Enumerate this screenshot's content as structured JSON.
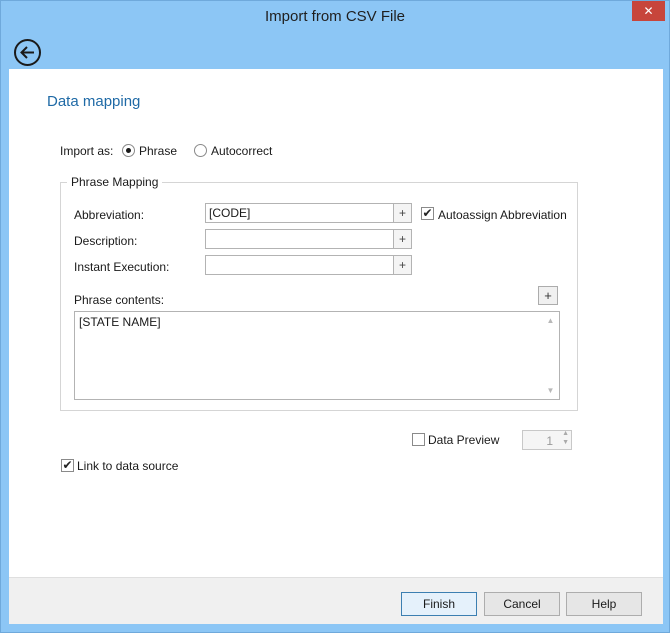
{
  "window": {
    "title": "Import from CSV File",
    "close_glyph": "✕"
  },
  "heading": "Data mapping",
  "import_as": {
    "label": "Import as:",
    "options": [
      "Phrase",
      "Autocorrect"
    ],
    "selected": "Phrase"
  },
  "phrase_mapping": {
    "title": "Phrase Mapping",
    "abbreviation": {
      "label": "Abbreviation:",
      "value": "[CODE]"
    },
    "description": {
      "label": "Description:",
      "value": ""
    },
    "instant_execution": {
      "label": "Instant Execution:",
      "value": ""
    },
    "autoassign": {
      "label": "Autoassign Abbreviation",
      "checked": true
    },
    "phrase_contents": {
      "label": "Phrase contents:",
      "value": "[STATE NAME]"
    },
    "plus_glyph": "+"
  },
  "data_preview": {
    "label": "Data Preview",
    "checked": false,
    "value": "1"
  },
  "link_to_source": {
    "label": "Link to data source",
    "checked": true
  },
  "buttons": {
    "finish": "Finish",
    "cancel": "Cancel",
    "help": "Help"
  },
  "icons": {
    "back": "back-arrow-icon",
    "close": "close-icon",
    "check": "✔"
  },
  "colors": {
    "frame": "#8cc6f5",
    "heading": "#1f6aa6",
    "close_button": "#c7453b"
  }
}
